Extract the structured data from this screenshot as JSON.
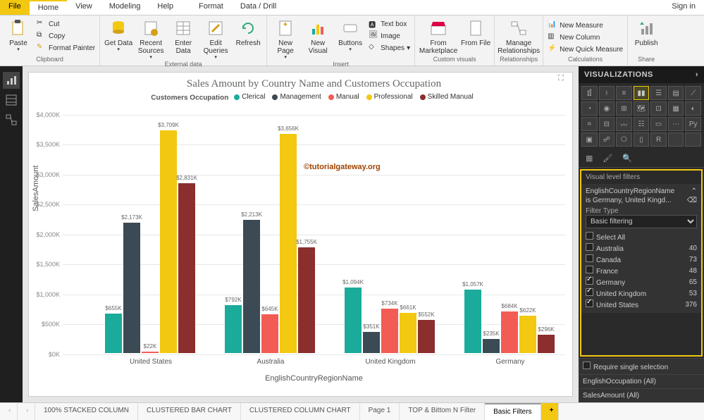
{
  "tabs": {
    "file": "File",
    "home": "Home",
    "view": "View",
    "modeling": "Modeling",
    "help": "Help",
    "format": "Format",
    "data_drill": "Data / Drill",
    "signin": "Sign in"
  },
  "ribbon": {
    "clipboard": {
      "paste": "Paste",
      "cut": "Cut",
      "copy": "Copy",
      "fmt": "Format Painter",
      "label": "Clipboard"
    },
    "external": {
      "get": "Get Data",
      "recent": "Recent Sources",
      "enter": "Enter Data",
      "edit": "Edit Queries",
      "refresh": "Refresh",
      "label": "External data"
    },
    "insert": {
      "page": "New Page",
      "visual": "New Visual",
      "buttons": "Buttons",
      "textbox": "Text box",
      "image": "Image",
      "shapes": "Shapes",
      "label": "Insert"
    },
    "custom": {
      "market": "From Marketplace",
      "file": "From File",
      "label": "Custom visuals"
    },
    "rel": {
      "manage": "Manage Relationships",
      "label": "Relationships"
    },
    "calc": {
      "measure": "New Measure",
      "column": "New Column",
      "quick": "New Quick Measure",
      "label": "Calculations"
    },
    "share": {
      "publish": "Publish",
      "label": "Share"
    }
  },
  "chart_data": {
    "type": "bar",
    "title": "Sales Amount by Country Name and Customers Occupation",
    "legend_title": "Customers Occupation",
    "xlabel": "EnglishCountryRegionName",
    "ylabel": "SalesAmount",
    "ylim": [
      0,
      4000000
    ],
    "yticks": [
      "$0K",
      "$500K",
      "$1,000K",
      "$1,500K",
      "$2,000K",
      "$2,500K",
      "$3,000K",
      "$3,500K",
      "$4,000K"
    ],
    "categories": [
      "United States",
      "Australia",
      "United Kingdom",
      "Germany"
    ],
    "series": [
      {
        "name": "Clerical",
        "color": "#1aab9b",
        "labels": [
          "$655K",
          "$792K",
          "$1,094K",
          "$1,057K"
        ],
        "values": [
          655,
          792,
          1094,
          1057
        ]
      },
      {
        "name": "Management",
        "color": "#3b4a54",
        "labels": [
          "$2,173K",
          "$2,213K",
          "$351K",
          "$235K"
        ],
        "values": [
          2173,
          2213,
          351,
          235
        ]
      },
      {
        "name": "Manual",
        "color": "#f25c54",
        "labels": [
          "$22K",
          "$645K",
          "$734K",
          "$684K"
        ],
        "values": [
          22,
          645,
          734,
          684
        ]
      },
      {
        "name": "Professional",
        "color": "#f2c811",
        "labels": [
          "$3,709K",
          "$3,656K",
          "$661K",
          "$622K"
        ],
        "values": [
          3709,
          3656,
          661,
          622
        ]
      },
      {
        "name": "Skilled Manual",
        "color": "#8b2e2e",
        "labels": [
          "$2,831K",
          "$1,755K",
          "$552K",
          "$296K"
        ],
        "values": [
          2831,
          1755,
          552,
          296
        ]
      }
    ]
  },
  "watermark": "©tutorialgateway.org",
  "vis": {
    "title": "VISUALIZATIONS"
  },
  "filters": {
    "header": "Visual level filters",
    "field": "EnglishCountryRegionName",
    "summary": "is Germany, United Kingd...",
    "type_label": "Filter Type",
    "type_value": "Basic filtering",
    "items": [
      {
        "label": "Select All",
        "count": "",
        "checked": false
      },
      {
        "label": "Australia",
        "count": "40",
        "checked": false
      },
      {
        "label": "Canada",
        "count": "73",
        "checked": false
      },
      {
        "label": "France",
        "count": "48",
        "checked": false
      },
      {
        "label": "Germany",
        "count": "65",
        "checked": true
      },
      {
        "label": "United Kingdom",
        "count": "53",
        "checked": true
      },
      {
        "label": "United States",
        "count": "376",
        "checked": true
      }
    ],
    "require": "Require single selection",
    "other1": "EnglishOccupation (All)",
    "other2": "SalesAmount (All)"
  },
  "pagetabs": [
    "100% STACKED COLUMN",
    "CLUSTERED BAR CHART",
    "CLUSTERED COLUMN CHART",
    "Page 1",
    "TOP & Bittom N Filter",
    "Basic Filters"
  ]
}
